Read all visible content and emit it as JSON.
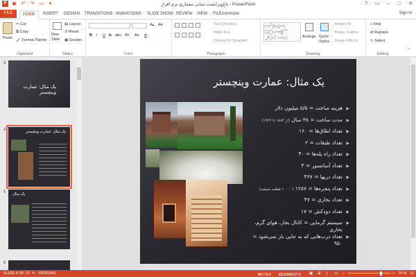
{
  "window": {
    "title": "باغ‌ویرایشت مبانی معماری نرم افزار - PowerPoint",
    "controls": [
      "?",
      "▭",
      "–",
      "□",
      "✕"
    ]
  },
  "tabs": [
    "FILE",
    "HOME",
    "INSERT",
    "DESIGN",
    "TRANSITIONS",
    "ANIMATIONS",
    "SLIDE SHOW",
    "REVIEW",
    "VIEW",
    "FILEminimizer"
  ],
  "signin": "Sign in",
  "ribbon": {
    "clipboard": {
      "paste": "Paste",
      "cut": "Cut",
      "copy": "Copy",
      "format_painter": "Format Painter",
      "label": "Clipboard"
    },
    "slides": {
      "new_slide": "New Slide",
      "layout": "Layout",
      "reset": "Reset",
      "section": "Section",
      "label": "Slides"
    },
    "font": {
      "label": "Font",
      "bold": "B",
      "italic": "I",
      "underline": "U",
      "strike": "S",
      "shadow": "abc",
      "spacing": "AV",
      "case": "Aa",
      "color": "A"
    },
    "paragraph": {
      "label": "Paragraph",
      "text_direction": "Text Direction",
      "align_text": "Align Text",
      "convert_smartart": "Convert to SmartArt"
    },
    "drawing": {
      "label": "Drawing",
      "arrange": "Arrange",
      "quick_styles": "Quick Styles",
      "shape_fill": "Shape Fill",
      "shape_outline": "Shape Outline",
      "shape_effects": "Shape Effects"
    },
    "editing": {
      "label": "Editing",
      "find": "Find",
      "replace": "Replace",
      "select": "Select"
    }
  },
  "thumbnails": [
    {
      "num": "3",
      "title": "یک مثال: عمارت وینچستر"
    },
    {
      "num": "4",
      "title": "یک مثال: عمارت وینچستر"
    },
    {
      "num": "5",
      "title": "یک مثال"
    },
    {
      "num": "6",
      "title": ""
    }
  ],
  "slide": {
    "title": "یک مثال: عمارت وینچستر",
    "bullets": [
      {
        "text": "هزینه ساخت = ۵/۵ میلیون دلار",
        "note": ""
      },
      {
        "text": "مدت ساخت = ۳۸ سال ",
        "note": "(از ۱۸۸۴ تا ۱۹۲۲)"
      },
      {
        "text": "تعداد اطاق‌ها = ۱۶۰",
        "note": ""
      },
      {
        "text": "تعداد طبقات = ۲",
        "note": ""
      },
      {
        "text": "تعداد راه پله‌ها = ۴۰",
        "note": ""
      },
      {
        "text": "تعداد آسانسور = ۳",
        "note": ""
      },
      {
        "text": "تعداد دربها = ۴۶۷",
        "note": ""
      },
      {
        "text": "تعداد پنجره‌ها = ۱۲۵۷ ",
        "note": "(۱۰۰۰۰ قطعه شیشه)"
      },
      {
        "text": "تعداد بخاری = ۴۷",
        "note": ""
      },
      {
        "text": "تعداد دودکش = ۱۷",
        "note": ""
      },
      {
        "text": "سیستم گرمایی = کانال بخار، هوای گرم، بخاری",
        "note": ""
      },
      {
        "text": "تعداد درب‌هایی که به جایی باز نمی‌شود = ۹۵۰",
        "note": ""
      }
    ]
  },
  "status": {
    "slide_info": "SLIDE 4 OF 73",
    "language": "PERSIAN",
    "notes": "NOTES",
    "comments": "COMMENTS",
    "zoom": "74 %"
  },
  "colors": {
    "accent": "#d24726",
    "slide_bg": "#2b2930",
    "selected_outline": "#e0653f"
  }
}
